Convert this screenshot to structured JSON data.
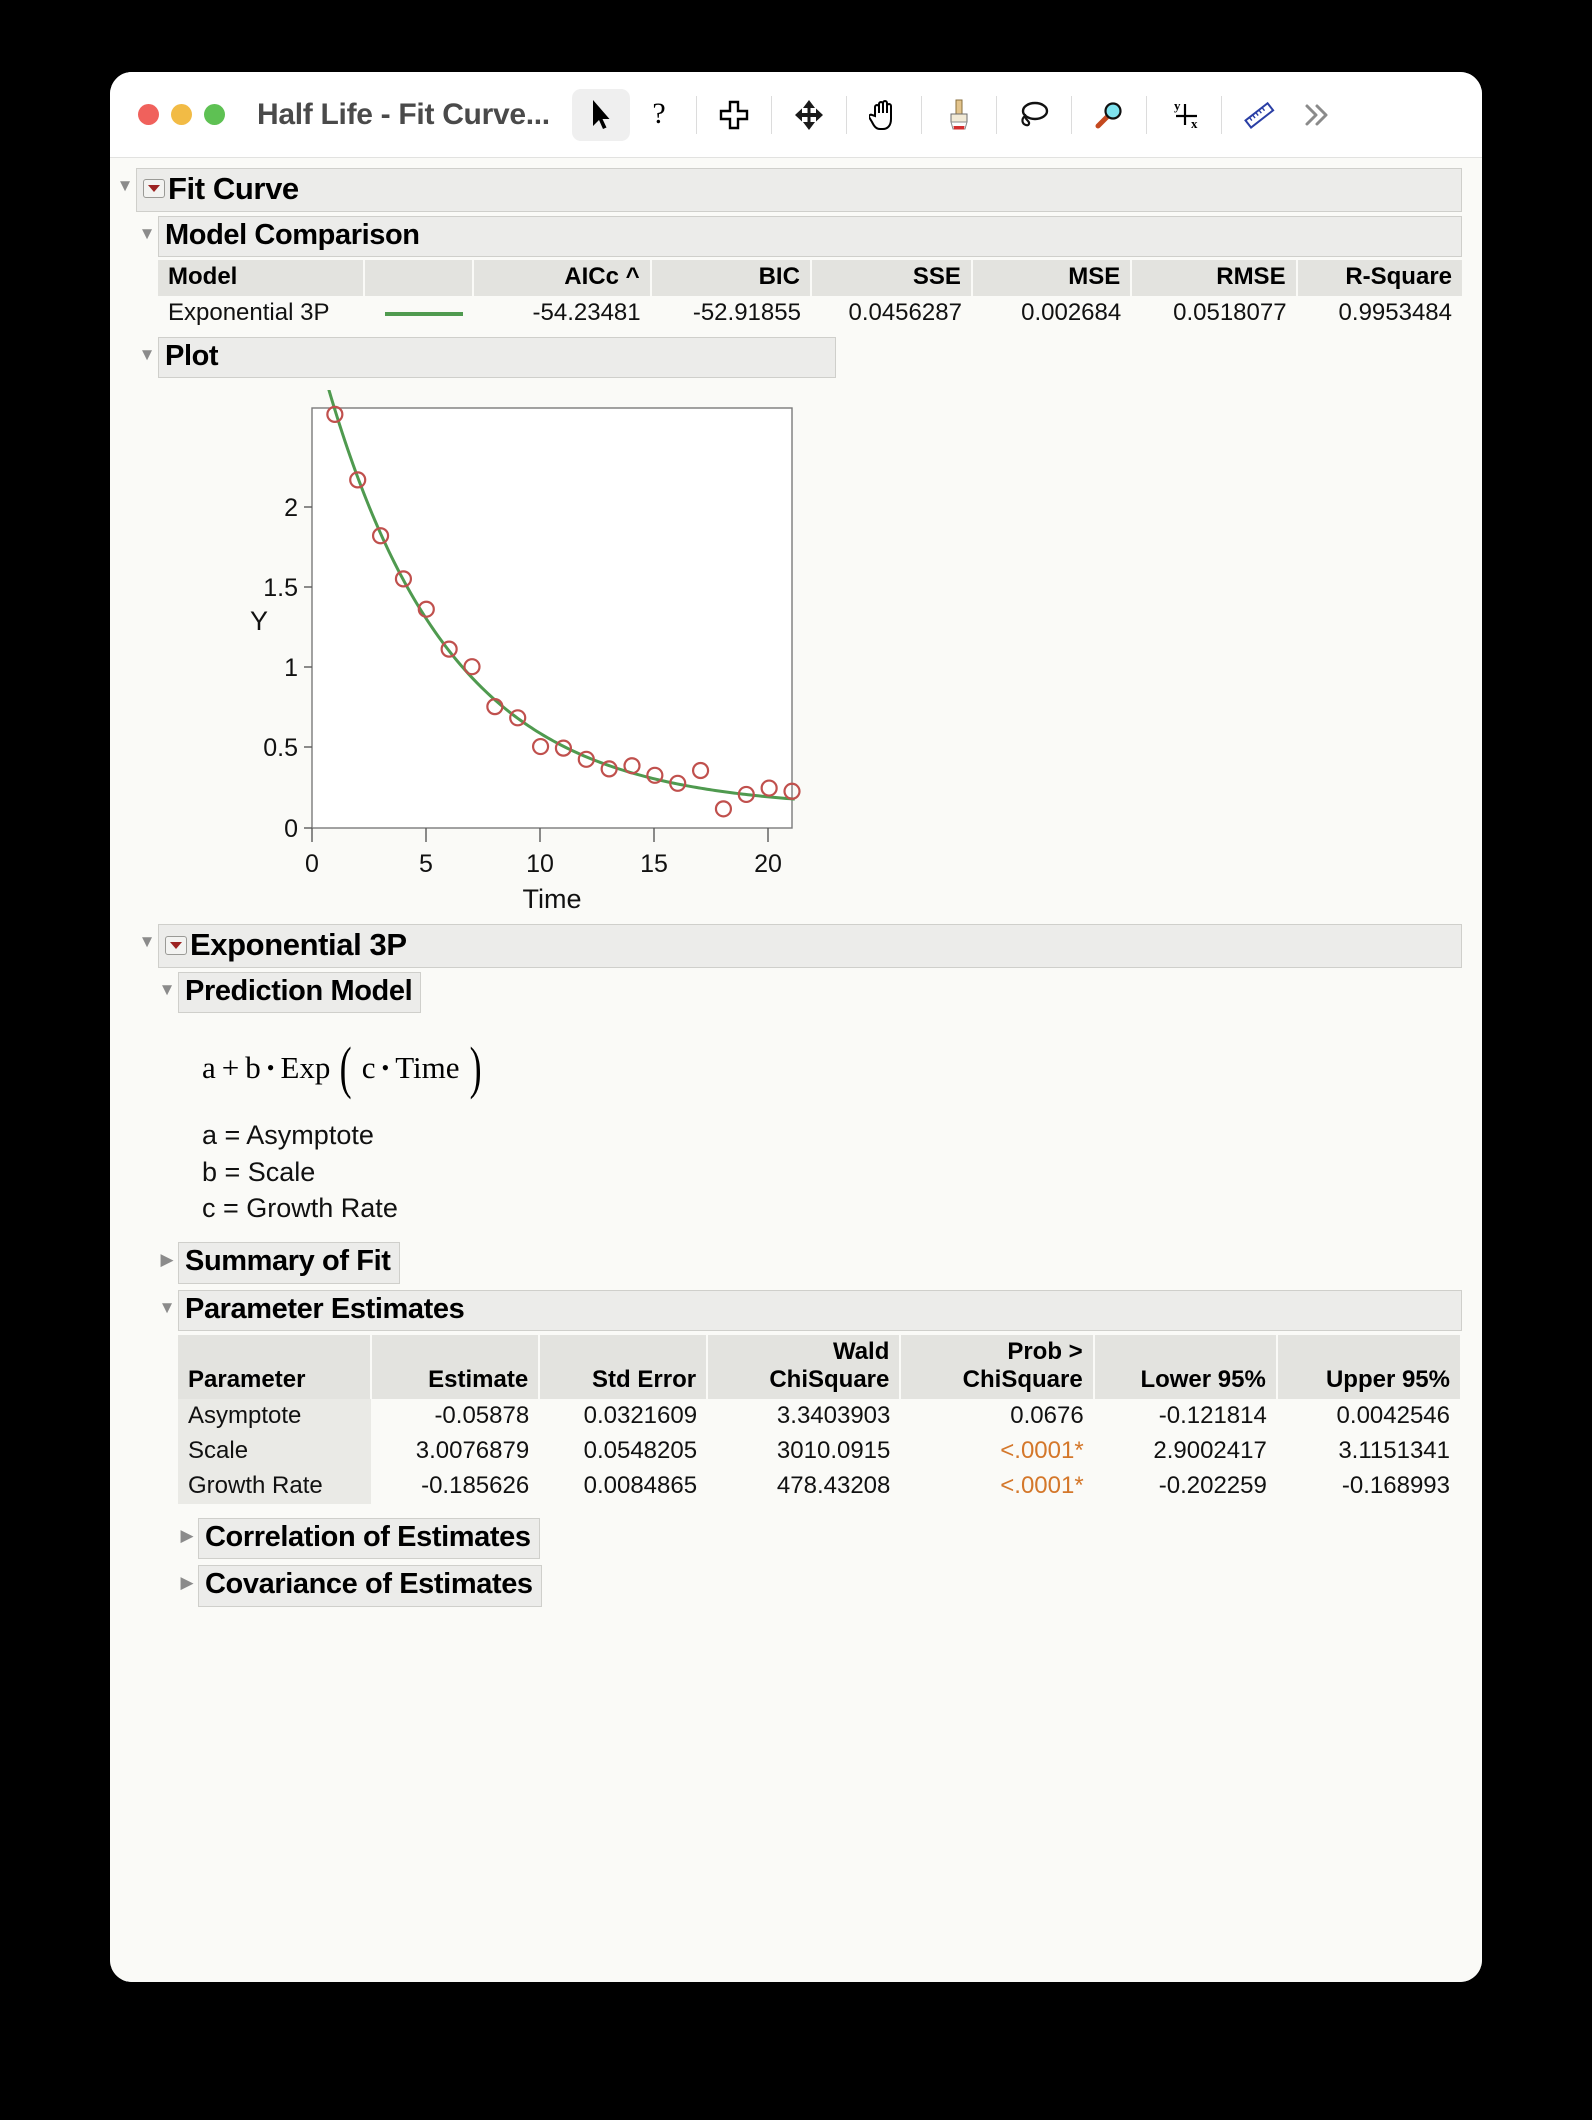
{
  "window": {
    "title": "Half Life - Fit Curve...",
    "traffic_lights": [
      "close",
      "minimize",
      "zoom"
    ]
  },
  "toolbar": {
    "items": [
      {
        "name": "arrow-select-tool",
        "label": "Select",
        "active": true
      },
      {
        "name": "question-help-tool",
        "label": "Help",
        "active": false
      },
      {
        "name": "crosshair-plus-tool",
        "label": "Crosshairs",
        "active": false
      },
      {
        "name": "move-arrows-tool",
        "label": "Move",
        "active": false
      },
      {
        "name": "hand-grabber-tool",
        "label": "Grabber",
        "active": false
      },
      {
        "name": "paintbrush-tool",
        "label": "Brush",
        "active": false
      },
      {
        "name": "lasso-tool",
        "label": "Lasso",
        "active": false
      },
      {
        "name": "magnifier-tool",
        "label": "Magnifier",
        "active": false
      },
      {
        "name": "yx-crosshair-tool",
        "label": "Crosshairs YX",
        "active": false
      },
      {
        "name": "ruler-annotate-tool",
        "label": "Annotate",
        "active": false
      },
      {
        "name": "overflow-chevrons",
        "label": "More",
        "active": false
      }
    ]
  },
  "outline": {
    "fit_curve": "Fit Curve",
    "model_comparison": "Model Comparison",
    "plot": "Plot",
    "exponential_3p": "Exponential 3P",
    "prediction_model": "Prediction Model",
    "summary_of_fit": "Summary of Fit",
    "parameter_estimates": "Parameter Estimates",
    "correlation_of_estimates": "Correlation of Estimates",
    "covariance_of_estimates": "Covariance of Estimates"
  },
  "model_comparison": {
    "columns": [
      "Model",
      "",
      "AICc ^",
      "BIC",
      "SSE",
      "MSE",
      "RMSE",
      "R-Square"
    ],
    "rows": [
      {
        "model": "Exponential 3P",
        "curve": "",
        "aicc": "-54.23481",
        "bic": "-52.91855",
        "sse": "0.0456287",
        "mse": "0.002684",
        "rmse": "0.0518077",
        "rsquare": "0.9953484"
      }
    ],
    "sort_indicator": "^",
    "sorted_column": "AICc"
  },
  "prediction_model": {
    "formula_parts": [
      "a",
      "+",
      "b",
      "•",
      "Exp",
      "(",
      "c",
      "•",
      "Time",
      ")"
    ],
    "definitions": [
      "a = Asymptote",
      "b = Scale",
      "c = Growth Rate"
    ]
  },
  "parameter_estimates": {
    "columns": [
      "Parameter",
      "Estimate",
      "Std Error",
      "Wald ChiSquare",
      "Prob > ChiSquare",
      "Lower 95%",
      "Upper 95%"
    ],
    "header_lines": {
      "wald": [
        "Wald",
        "ChiSquare"
      ],
      "prob": [
        "Prob >",
        "ChiSquare"
      ]
    },
    "rows": [
      {
        "parameter": "Asymptote",
        "estimate": "-0.05878",
        "std_error": "0.0321609",
        "wald_chisquare": "3.3403903",
        "prob_chisquare": "0.0676",
        "prob_significant": false,
        "lower95": "-0.121814",
        "upper95": "0.0042546"
      },
      {
        "parameter": "Scale",
        "estimate": "3.0076879",
        "std_error": "0.0548205",
        "wald_chisquare": "3010.0915",
        "prob_chisquare": "<.0001*",
        "prob_significant": true,
        "lower95": "2.9002417",
        "upper95": "3.1151341"
      },
      {
        "parameter": "Growth Rate",
        "estimate": "-0.185626",
        "std_error": "0.0084865",
        "wald_chisquare": "478.43208",
        "prob_chisquare": "<.0001*",
        "prob_significant": true,
        "lower95": "-0.202259",
        "upper95": "-0.168993"
      }
    ]
  },
  "chart_data": {
    "type": "scatter",
    "title": "Plot",
    "xlabel": "Time",
    "ylabel": "Y",
    "xlim": [
      0,
      21
    ],
    "ylim": [
      -0.18,
      2.45
    ],
    "xticks": [
      0,
      5,
      10,
      15,
      20
    ],
    "yticks": [
      0,
      0.5,
      1,
      1.5,
      2
    ],
    "grid": false,
    "legend": false,
    "marker_color": "#c0504d",
    "marker_style": "open-circle",
    "fit_line_color": "#4f9a4f",
    "fit_model": "Exponential 3P",
    "fit_equation": "Y = a + b * Exp(c * Time)",
    "fit_params": {
      "a": -0.05878,
      "b": 3.0076879,
      "c": -0.185626
    },
    "series": [
      {
        "name": "Y",
        "x": [
          1,
          2,
          3,
          4,
          5,
          6,
          7,
          8,
          9,
          10,
          11,
          12,
          13,
          14,
          15,
          16,
          17,
          18,
          19,
          20,
          21
        ],
        "y": [
          2.41,
          2.0,
          1.65,
          1.38,
          1.19,
          0.94,
          0.83,
          0.58,
          0.51,
          0.33,
          0.32,
          0.25,
          0.19,
          0.21,
          0.15,
          0.1,
          0.18,
          -0.06,
          0.03,
          0.07,
          0.05
        ]
      }
    ]
  }
}
